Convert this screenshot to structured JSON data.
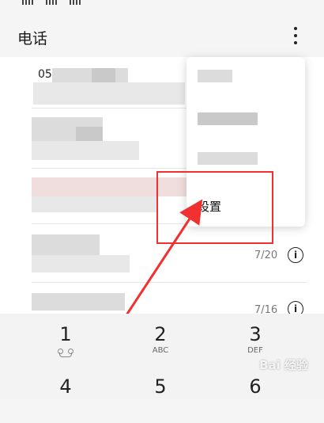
{
  "app": {
    "title": "电话"
  },
  "header": {
    "more_icon": "more-vertical-icon"
  },
  "call_log": {
    "partial_number": "05",
    "dates": [
      "7/20",
      "7/16"
    ],
    "info_glyph": "i"
  },
  "menu": {
    "settings_label": "设置"
  },
  "annotation": {
    "color": "#f0312f"
  },
  "dialpad": {
    "keys": [
      {
        "digit": "1",
        "letters": ""
      },
      {
        "digit": "2",
        "letters": "ABC"
      },
      {
        "digit": "3",
        "letters": "DEF"
      },
      {
        "digit": "4",
        "letters": ""
      },
      {
        "digit": "5",
        "letters": ""
      },
      {
        "digit": "6",
        "letters": ""
      }
    ]
  },
  "watermark": {
    "text": "Bai 经验"
  }
}
